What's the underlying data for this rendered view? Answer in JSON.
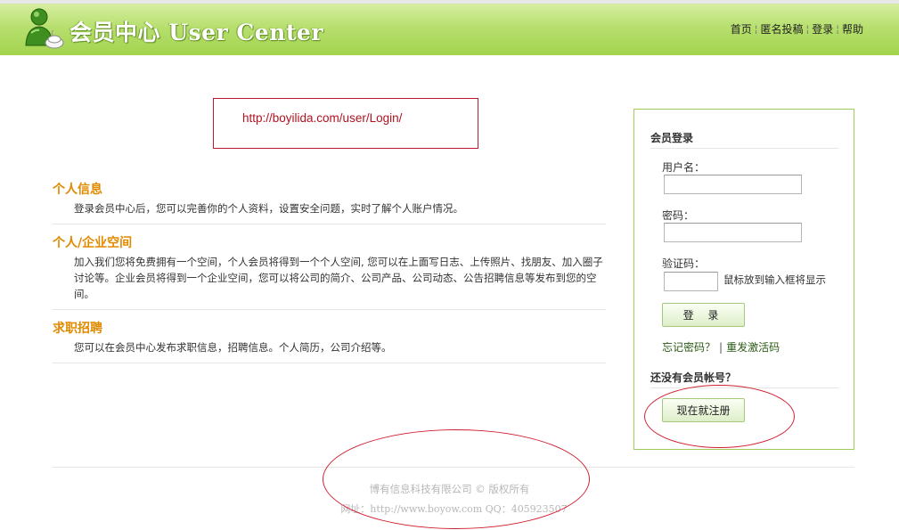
{
  "header": {
    "logo_text": "会员中心 User Center",
    "nav": [
      "首页",
      "匿名投稿",
      "登录",
      "帮助"
    ],
    "nav_separator": "¦"
  },
  "annotation_url": "http://boyilida.com/user/Login/",
  "sections": [
    {
      "title": "个人信息",
      "text": "登录会员中心后，您可以完善你的个人资料，设置安全问题，实时了解个人账户情况。"
    },
    {
      "title": "个人/企业空间",
      "text": "加入我们您将免费拥有一个空间，个人会员将得到一个个人空间, 您可以在上面写日志、上传照片、找朋友、加入圈子讨论等。企业会员将得到一个企业空间，您可以将公司的简介、公司产品、公司动态、公告招聘信息等发布到您的空间。"
    },
    {
      "title": "求职招聘",
      "text": "您可以在会员中心发布求职信息，招聘信息。个人简历，公司介绍等。"
    }
  ],
  "login": {
    "title": "会员登录",
    "username_label": "用户名：",
    "username_value": "",
    "password_label": "密码：",
    "password_value": "",
    "captcha_label": "验证码：",
    "captcha_value": "",
    "captcha_hint": "鼠标放到输入框将显示",
    "login_button": "登 录",
    "forgot_password": "忘记密码？",
    "link_separator": "|",
    "resend_activation": "重发激活码",
    "no_account": "还没有会员帐号？",
    "register_button": "现在就注册"
  },
  "footer": {
    "copyright": "博有信息科技有限公司 © 版权所有",
    "address": "网址：http://www.boyow.com QQ：405923507"
  },
  "colors": {
    "header_green": "#a2d44d",
    "section_title_orange": "#e08a00",
    "annotation_red": "#c0182c",
    "panel_border": "#9fcc5a"
  }
}
